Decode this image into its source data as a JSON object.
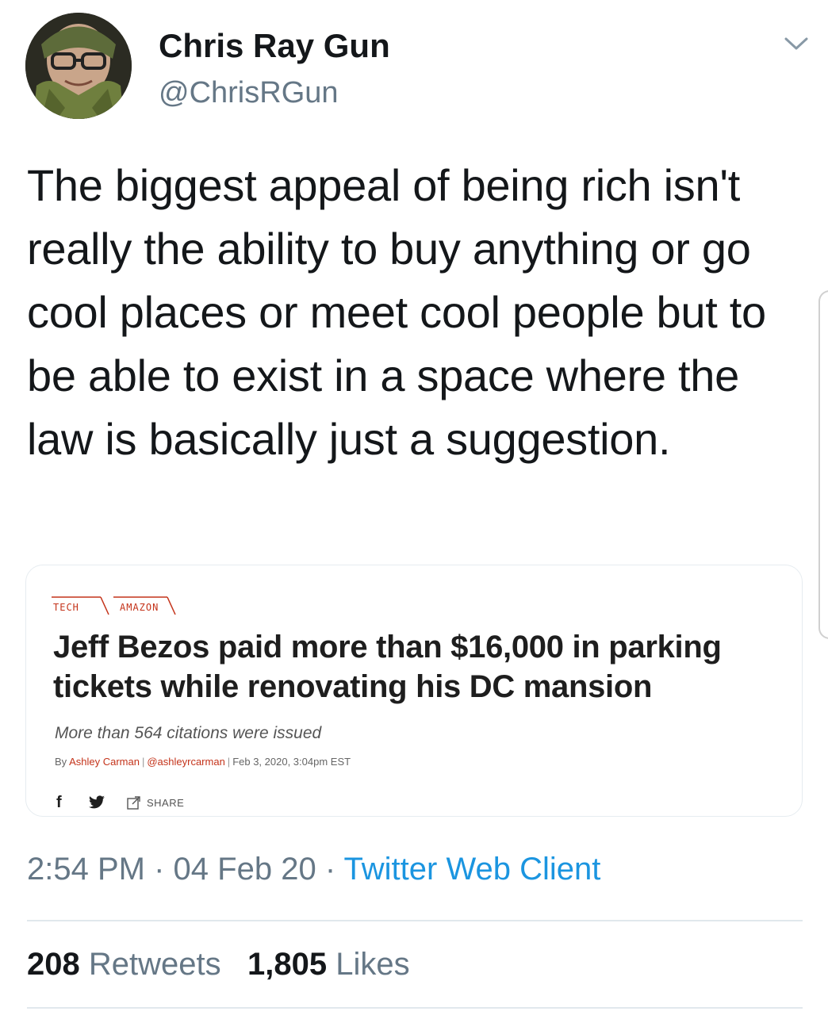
{
  "header": {
    "display_name": "Chris Ray Gun",
    "handle": "@ChrisRGun",
    "avatar_icon": "avatar-photo",
    "menu_icon": "chevron-down-icon"
  },
  "tweet": {
    "text": "The biggest appeal of being rich isn't really the ability to buy anything or go cool places or meet cool people but to be able to exist in a space where the law is basically just a suggestion."
  },
  "card": {
    "tags": [
      "TECH",
      "AMAZON"
    ],
    "title": "Jeff Bezos paid more than $16,000 in parking tickets while renovating his DC mansion",
    "subtitle": "More than 564 citations were issued",
    "byline": {
      "prefix": "By",
      "author": "Ashley Carman",
      "author_handle": "@ashleyrcarman",
      "date": "Feb 3, 2020, 3:04pm EST"
    },
    "share_label": "SHARE",
    "accent_color": "#c4331a"
  },
  "meta": {
    "time": "2:54 PM",
    "date": "04 Feb 20",
    "separator": "·",
    "source": "Twitter Web Client",
    "source_color": "#1b95e0"
  },
  "stats": {
    "retweets_count": "208",
    "retweets_label": "Retweets",
    "likes_count": "1,805",
    "likes_label": "Likes"
  }
}
